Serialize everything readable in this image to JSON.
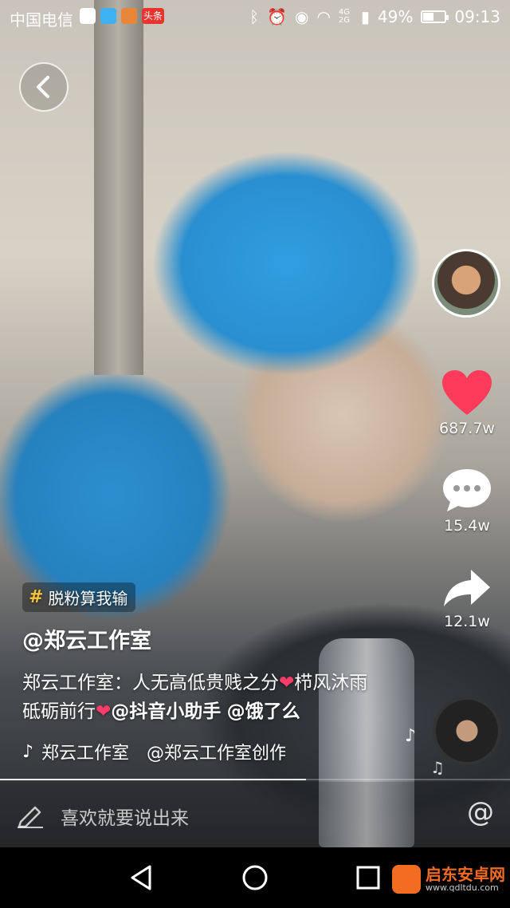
{
  "status_bar": {
    "carrier": "中国电信",
    "battery": "49%",
    "battery_level": 0.49,
    "time": "09:13",
    "network": "4G 2G",
    "app_badge": "头条"
  },
  "sidebar": {
    "likes": "687.7w",
    "comments": "15.4w",
    "shares": "12.1w"
  },
  "caption": {
    "hashtag": "脱粉算我输",
    "author": "@郑云工作室",
    "desc_text": "郑云工作室：人无高低贵贱之分",
    "heart": "❤",
    "desc_text2": "栉风沐雨 砥砺前行",
    "mention1": "@抖音小助手",
    "mention2": "@饿了么",
    "music": "郑云工作室　@郑云工作室创作的原声"
  },
  "comment_bar": {
    "placeholder": "喜欢就要说出来",
    "at_symbol": "@"
  },
  "watermark": {
    "title": "启东安卓网",
    "url": "www.qdltdu.com"
  },
  "colors": {
    "like_red": "#ff3b5c",
    "hashtag_yellow": "#f6c338",
    "helmet_blue": "#2f9ee0",
    "watermark_orange": "#f36c21"
  },
  "progress": 0.6
}
